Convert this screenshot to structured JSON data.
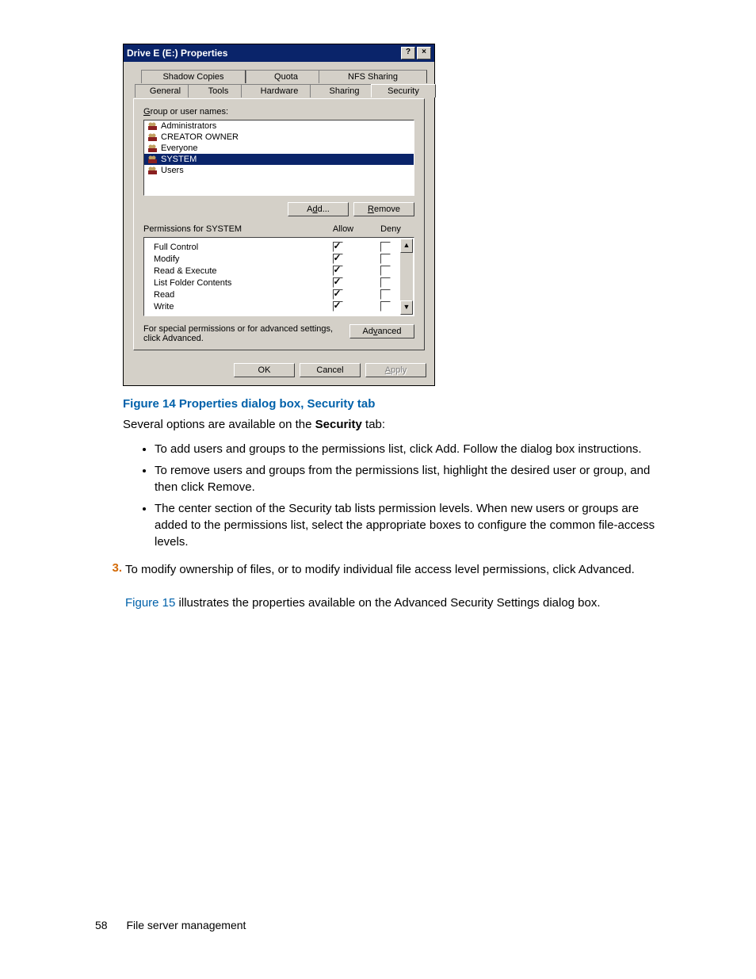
{
  "dialog": {
    "title": "Drive E (E:) Properties",
    "help_btn": "?",
    "close_btn": "×",
    "tabs": {
      "shadow": "Shadow Copies",
      "quota": "Quota",
      "nfs": "NFS Sharing",
      "general": "General",
      "tools": "Tools",
      "hardware": "Hardware",
      "sharing": "Sharing",
      "security": "Security"
    },
    "group_label_pre": "G",
    "group_label_post": "roup or user names:",
    "users": [
      "Administrators",
      "CREATOR OWNER",
      "Everyone",
      "SYSTEM",
      "Users"
    ],
    "selected_user_index": 3,
    "add_btn_pre": "A",
    "add_btn_u": "d",
    "add_btn_post": "d...",
    "remove_btn_u": "R",
    "remove_btn_post": "emove",
    "perm_label_pre": "P",
    "perm_label_post": "ermissions for SYSTEM",
    "allow": "Allow",
    "deny": "Deny",
    "perms": [
      {
        "name": "Full Control",
        "allow": true,
        "deny": false
      },
      {
        "name": "Modify",
        "allow": true,
        "deny": false
      },
      {
        "name": "Read & Execute",
        "allow": true,
        "deny": false
      },
      {
        "name": "List Folder Contents",
        "allow": true,
        "deny": false
      },
      {
        "name": "Read",
        "allow": true,
        "deny": false
      },
      {
        "name": "Write",
        "allow": true,
        "deny": false
      }
    ],
    "adv_text": "For special permissions or for advanced settings, click Advanced.",
    "adv_btn_pre": "Ad",
    "adv_btn_u": "v",
    "adv_btn_post": "anced",
    "ok": "OK",
    "cancel": "Cancel",
    "apply": "Apply",
    "apply_u": "A"
  },
  "doc": {
    "figcap": "Figure 14 Properties dialog box, Security tab",
    "intro_pre": "Several options are available on the ",
    "intro_b": "Security",
    "intro_post": " tab:",
    "bul1_pre": "To add users and groups to the permissions list, click ",
    "bul1_b": "Add",
    "bul1_post": ". Follow the dialog box instructions.",
    "bul2_pre": "To remove users and groups from the permissions list, highlight the desired user or group, and then click ",
    "bul2_b": "Remove",
    "bul2_post": ".",
    "bul3_pre": "The center section of the ",
    "bul3_b": "Security",
    "bul3_post": " tab lists permission levels. When new users or groups are added to the permissions list, select the appropriate boxes to configure the common file-access levels.",
    "ol_num": "3.",
    "ol_pre": "To modify ownership of files, or to modify individual file access level permissions, click ",
    "ol_b": "Advanced",
    "ol_post": ".",
    "fig15": "Figure 15",
    "fig15_mid": " illustrates the properties available on the ",
    "fig15_b": "Advanced Security Settings",
    "fig15_post": " dialog box.",
    "page_num": "58",
    "section": "File server management"
  }
}
